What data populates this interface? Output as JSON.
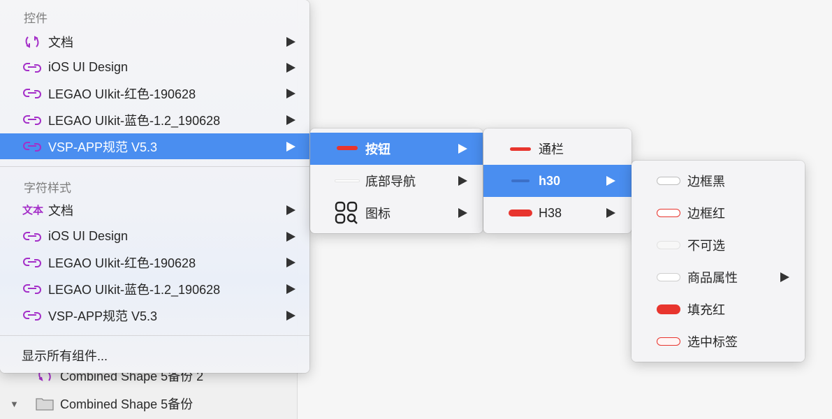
{
  "background_layers": [
    {
      "label": "Combined Shape 5备份 2",
      "icon": "symbol-instance-icon"
    },
    {
      "label": "Combined Shape 5备份",
      "icon": "folder-icon"
    }
  ],
  "main_menu": {
    "sections": [
      {
        "title": "控件",
        "items": [
          {
            "label": "文档",
            "icon": "refresh-symbol-icon"
          },
          {
            "label": "iOS UI Design",
            "icon": "link-library-icon"
          },
          {
            "label": "LEGAO UIkit-红色-190628",
            "icon": "link-library-icon"
          },
          {
            "label": "LEGAO UIkit-蓝色-1.2_190628",
            "icon": "link-library-icon"
          },
          {
            "label": "VSP-APP规范 V5.3",
            "icon": "link-library-icon",
            "selected": true
          }
        ]
      },
      {
        "title": "字符样式",
        "items": [
          {
            "label": "文档",
            "icon": "text-style-icon",
            "icon_text": "文本"
          },
          {
            "label": "iOS UI Design",
            "icon": "link-library-icon"
          },
          {
            "label": "LEGAO UIkit-红色-190628",
            "icon": "link-library-icon"
          },
          {
            "label": "LEGAO UIkit-蓝色-1.2_190628",
            "icon": "link-library-icon"
          },
          {
            "label": "VSP-APP规范 V5.3",
            "icon": "link-library-icon"
          }
        ]
      }
    ],
    "footer": "显示所有组件..."
  },
  "submenu_1": [
    {
      "label": "按钮",
      "selected": true
    },
    {
      "label": "底部导航"
    },
    {
      "label": "图标",
      "icon": "grid-search-icon"
    }
  ],
  "submenu_2": [
    {
      "label": "通栏"
    },
    {
      "label": "h30",
      "selected": true
    },
    {
      "label": "H38"
    }
  ],
  "submenu_3": [
    {
      "label": "边框黑"
    },
    {
      "label": "边框红"
    },
    {
      "label": "不可选"
    },
    {
      "label": "商品属性",
      "has_submenu": true
    },
    {
      "label": "填充红"
    },
    {
      "label": "选中标签"
    }
  ],
  "colors": {
    "selection": "#4a8ef0",
    "library_icon": "#a42fc8",
    "accent_red": "#e8352e"
  }
}
